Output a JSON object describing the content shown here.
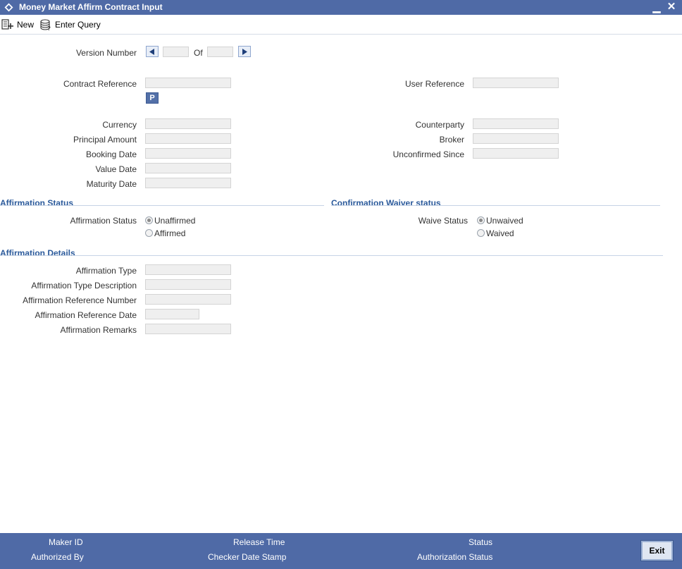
{
  "window": {
    "title": "Money Market Affirm Contract Input",
    "minimize_glyph": "▁",
    "close_glyph": "✕"
  },
  "toolbar": {
    "new_label": "New",
    "enter_query_label": "Enter Query"
  },
  "version": {
    "label": "Version Number",
    "of_label": "Of"
  },
  "contract": {
    "contract_reference_label": "Contract Reference",
    "p_button_label": "P",
    "user_reference_label": "User Reference",
    "currency_label": "Currency",
    "principal_amount_label": "Principal Amount",
    "booking_date_label": "Booking Date",
    "value_date_label": "Value Date",
    "maturity_date_label": "Maturity Date",
    "counterparty_label": "Counterparty",
    "broker_label": "Broker",
    "unconfirmed_since_label": "Unconfirmed Since"
  },
  "affirmation_status": {
    "section_title": "Affirmation Status",
    "field_label": "Affirmation Status",
    "options": [
      "Unaffirmed",
      "Affirmed"
    ],
    "selected": "Unaffirmed"
  },
  "waiver_status": {
    "section_title": "Confirmation Waiver status",
    "field_label": "Waive Status",
    "options": [
      "Unwaived",
      "Waived"
    ],
    "selected": "Unwaived"
  },
  "affirmation_details": {
    "section_title": "Affirmation Details",
    "type_label": "Affirmation Type",
    "type_description_label": "Affirmation Type Description",
    "reference_number_label": "Affirmation Reference Number",
    "reference_date_label": "Affirmation Reference Date",
    "remarks_label": "Affirmation Remarks"
  },
  "footer": {
    "maker_id_label": "Maker ID",
    "authorized_by_label": "Authorized By",
    "release_time_label": "Release Time",
    "checker_date_stamp_label": "Checker Date Stamp",
    "status_label": "Status",
    "authorization_status_label": "Authorization Status",
    "exit_label": "Exit"
  },
  "colors": {
    "header_bg": "#4f6aa6",
    "section_title": "#2b5a9b",
    "field_bg": "#efefef"
  }
}
